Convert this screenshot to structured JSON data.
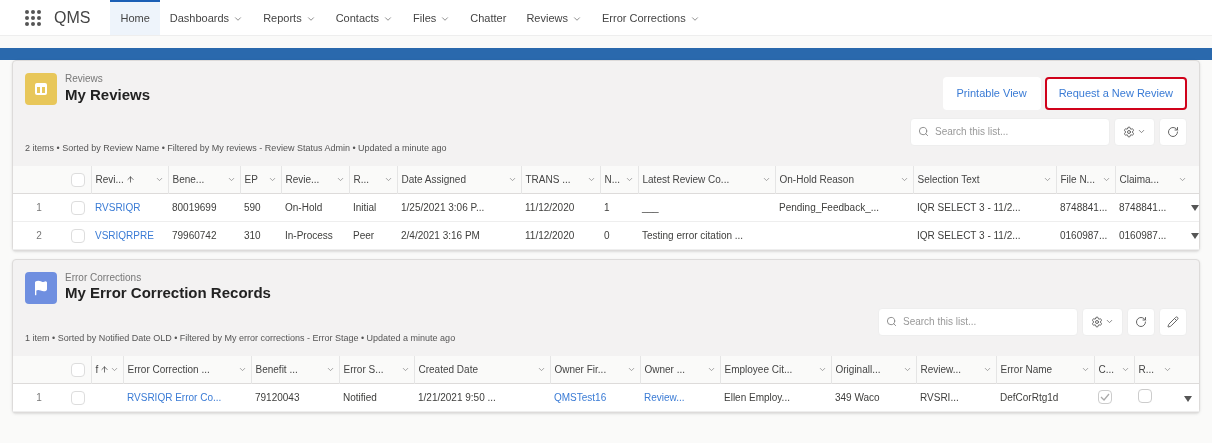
{
  "app": {
    "name": "QMS"
  },
  "nav": [
    {
      "label": "Home",
      "menu": false,
      "selected": true
    },
    {
      "label": "Dashboards",
      "menu": true,
      "selected": false
    },
    {
      "label": "Reports",
      "menu": true,
      "selected": false
    },
    {
      "label": "Contacts",
      "menu": true,
      "selected": false
    },
    {
      "label": "Files",
      "menu": true,
      "selected": false
    },
    {
      "label": "Chatter",
      "menu": false,
      "selected": false
    },
    {
      "label": "Reviews",
      "menu": true,
      "selected": false
    },
    {
      "label": "Error Corrections",
      "menu": true,
      "selected": false
    }
  ],
  "cards": [
    {
      "kind": "reviews",
      "object": "Reviews",
      "title": "My Reviews",
      "buttons": [
        {
          "label": "Printable View",
          "highlighted": false
        },
        {
          "label": "Request a New Review",
          "highlighted": true
        }
      ],
      "meta": "2 items • Sorted by Review Name • Filtered by My reviews - Review Status Admin • Updated a minute ago",
      "search": {
        "placeholder": "Search this list..."
      },
      "edit_tool": false,
      "all_selected": false,
      "columns": [
        {
          "label": "Revi...",
          "sorted": true
        },
        {
          "label": "Bene...",
          "sorted": false
        },
        {
          "label": "EP",
          "sorted": false
        },
        {
          "label": "Revie...",
          "sorted": false
        },
        {
          "label": "R...",
          "sorted": false
        },
        {
          "label": "Date Assigned",
          "sorted": false
        },
        {
          "label": "TRANS ...",
          "sorted": false
        },
        {
          "label": "N...",
          "sorted": false
        },
        {
          "label": "Latest Review Co...",
          "sorted": false
        },
        {
          "label": "On-Hold Reason",
          "sorted": false
        },
        {
          "label": "Selection Text",
          "sorted": false
        },
        {
          "label": "File N...",
          "sorted": false
        },
        {
          "label": "Claima...",
          "sorted": false
        }
      ],
      "rows": [
        {
          "number": "1",
          "selected": false,
          "cells": [
            {
              "kind": "link",
              "text": "RVSRIQR"
            },
            {
              "kind": "text",
              "text": "80019699"
            },
            {
              "kind": "text",
              "text": "590"
            },
            {
              "kind": "text",
              "text": "On-Hold"
            },
            {
              "kind": "text",
              "text": "Initial"
            },
            {
              "kind": "text",
              "text": "1/25/2021 3:06 P..."
            },
            {
              "kind": "text",
              "text": "11/12/2020"
            },
            {
              "kind": "text",
              "text": "1"
            },
            {
              "kind": "text",
              "text": "___"
            },
            {
              "kind": "text",
              "text": "Pending_Feedback_..."
            },
            {
              "kind": "text",
              "text": "IQR SELECT 3 - 11/2..."
            },
            {
              "kind": "text",
              "text": "8748841..."
            },
            {
              "kind": "text",
              "text": "8748841..."
            }
          ]
        },
        {
          "number": "2",
          "selected": false,
          "cells": [
            {
              "kind": "link",
              "text": "VSRIQRPRE"
            },
            {
              "kind": "text",
              "text": "79960742"
            },
            {
              "kind": "text",
              "text": "310"
            },
            {
              "kind": "text",
              "text": "In-Process"
            },
            {
              "kind": "text",
              "text": "Peer"
            },
            {
              "kind": "text",
              "text": "2/4/2021 3:16 PM"
            },
            {
              "kind": "text",
              "text": "11/12/2020"
            },
            {
              "kind": "text",
              "text": "0"
            },
            {
              "kind": "text",
              "text": "Testing error citation ..."
            },
            {
              "kind": "empty"
            },
            {
              "kind": "text",
              "text": "IQR SELECT 3 - 11/2..."
            },
            {
              "kind": "text",
              "text": "0160987..."
            },
            {
              "kind": "text",
              "text": "0160987..."
            }
          ]
        }
      ]
    },
    {
      "kind": "errors",
      "object": "Error Corrections",
      "title": "My Error Correction Records",
      "meta": "1 item • Sorted by Notified Date OLD • Filtered by My error corrections - Error Stage • Updated a minute ago",
      "search": {
        "placeholder": "Search this list..."
      },
      "edit_tool": true,
      "all_selected": false,
      "columns": [
        {
          "label": "f",
          "sorted": true
        },
        {
          "label": "Error Correction ...",
          "sorted": false
        },
        {
          "label": "Benefit ...",
          "sorted": false
        },
        {
          "label": "Error S...",
          "sorted": false
        },
        {
          "label": "Created Date",
          "sorted": false
        },
        {
          "label": "Owner Fir...",
          "sorted": false
        },
        {
          "label": "Owner ...",
          "sorted": false
        },
        {
          "label": "Employee Cit...",
          "sorted": false
        },
        {
          "label": "Originall...",
          "sorted": false
        },
        {
          "label": "Review...",
          "sorted": false
        },
        {
          "label": "Error Name",
          "sorted": false
        },
        {
          "label": "C...",
          "sorted": false
        },
        {
          "label": "R...",
          "sorted": false
        }
      ],
      "rows": [
        {
          "number": "1",
          "selected": false,
          "cells": [
            {
              "kind": "empty"
            },
            {
              "kind": "link",
              "text": "RVSRIQR Error Co..."
            },
            {
              "kind": "text",
              "text": "79120043"
            },
            {
              "kind": "text",
              "text": "Notified"
            },
            {
              "kind": "text",
              "text": "1/21/2021 9:50 ..."
            },
            {
              "kind": "link",
              "text": "QMSTest16"
            },
            {
              "kind": "link",
              "text": "Review..."
            },
            {
              "kind": "text",
              "text": "Ellen Employ..."
            },
            {
              "kind": "text",
              "text": "349 Waco"
            },
            {
              "kind": "text",
              "text": "RVSRI..."
            },
            {
              "kind": "text",
              "text": "DefCorRtg1d"
            },
            {
              "kind": "check",
              "checked": true
            },
            {
              "kind": "check",
              "checked": false
            }
          ]
        }
      ]
    }
  ]
}
